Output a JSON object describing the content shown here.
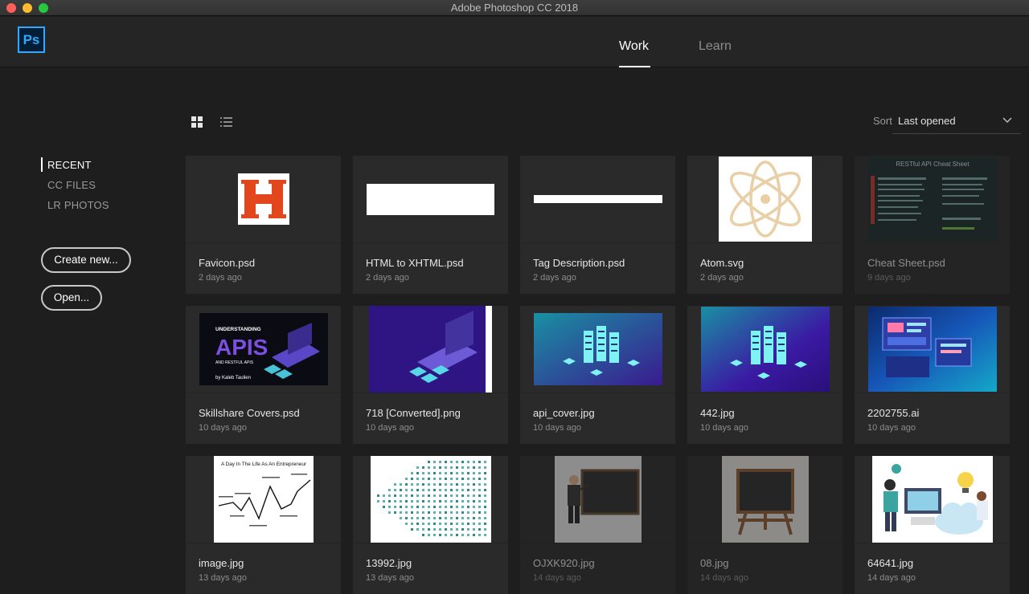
{
  "window": {
    "title": "Adobe Photoshop CC 2018"
  },
  "app": {
    "logo_text": "Ps"
  },
  "tabs": [
    {
      "label": "Work",
      "active": true
    },
    {
      "label": "Learn",
      "active": false
    }
  ],
  "sidebar": {
    "items": [
      {
        "label": "RECENT",
        "active": true
      },
      {
        "label": "CC FILES",
        "active": false
      },
      {
        "label": "LR PHOTOS",
        "active": false
      }
    ],
    "create_label": "Create new...",
    "open_label": "Open..."
  },
  "toolbar": {
    "grid_view_icon": "grid-view-icon",
    "list_view_icon": "list-view-icon",
    "sort_label": "Sort",
    "sort_value": "Last opened"
  },
  "colors": {
    "accent_ps": "#31a8ff",
    "background": "#1e1e1e",
    "card": "#2a2a2a"
  },
  "files": [
    {
      "name": "Favicon.psd",
      "date": "2 days ago",
      "thumb": "favicon-h"
    },
    {
      "name": "HTML to XHTML.psd",
      "date": "2 days ago",
      "thumb": "white-bar"
    },
    {
      "name": "Tag Description.psd",
      "date": "2 days ago",
      "thumb": "thin-bar"
    },
    {
      "name": "Atom.svg",
      "date": "2 days ago",
      "thumb": "atom-logo"
    },
    {
      "name": "Cheat Sheet.psd",
      "date": "9 days ago",
      "thumb": "cheat-sheet",
      "dim": true,
      "thumb_title": "RESTful API Cheat Sheet"
    },
    {
      "name": "Skillshare Covers.psd",
      "date": "10 days ago",
      "thumb": "apis-cover",
      "thumb_text": [
        "UNDERSTANDING",
        "APIS",
        "AND RESTFUL APIS",
        "by Kaleb Taulien"
      ]
    },
    {
      "name": "718 [Converted].png",
      "date": "10 days ago",
      "thumb": "purple-laptop"
    },
    {
      "name": "api_cover.jpg",
      "date": "10 days ago",
      "thumb": "server-teal"
    },
    {
      "name": "442.jpg",
      "date": "10 days ago",
      "thumb": "server-purple"
    },
    {
      "name": "2202755.ai",
      "date": "10 days ago",
      "thumb": "dashboard-blue"
    },
    {
      "name": "image.jpg",
      "date": "13 days ago",
      "thumb": "entrepreneur-chart",
      "thumb_title": "A Day In The Life As An Entrepreneur"
    },
    {
      "name": "13992.jpg",
      "date": "13 days ago",
      "thumb": "dot-pattern"
    },
    {
      "name": "OJXK920.jpg",
      "date": "14 days ago",
      "thumb": "teacher-board",
      "dim": true
    },
    {
      "name": "08.jpg",
      "date": "14 days ago",
      "thumb": "easel-board",
      "dim": true
    },
    {
      "name": "64641.jpg",
      "date": "14 days ago",
      "thumb": "people-cloud"
    }
  ]
}
